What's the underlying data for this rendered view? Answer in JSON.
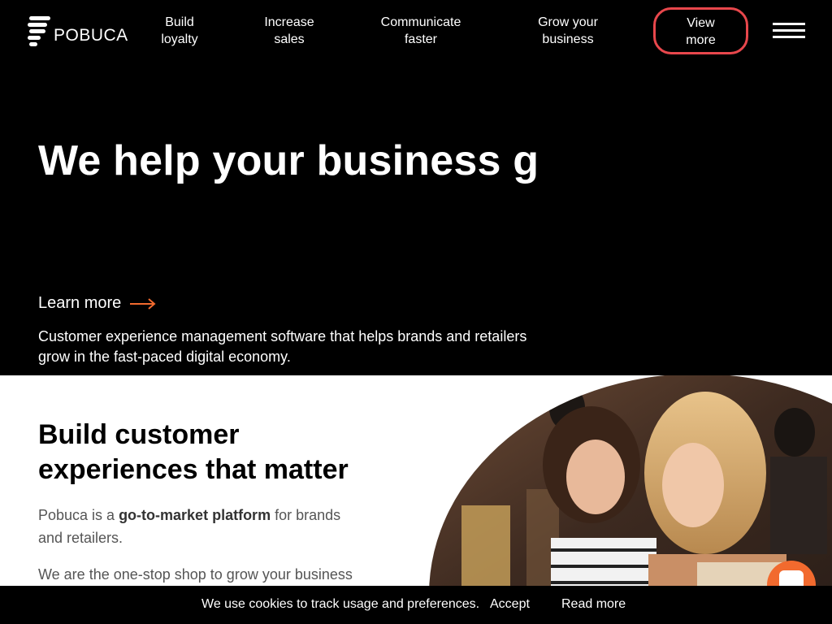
{
  "header": {
    "logo_text": "POBUCA",
    "nav": [
      {
        "line1": "Build",
        "line2": "loyalty"
      },
      {
        "line1": "Increase",
        "line2": "sales"
      },
      {
        "line1": "Communicate",
        "line2": "faster"
      },
      {
        "line1": "Grow your",
        "line2": "business"
      }
    ],
    "cta": {
      "line1": "View",
      "line2": "more"
    },
    "accent_color": "#e8474c"
  },
  "hero": {
    "title": "We help your business g",
    "learn_more": "Learn more",
    "arrow_color": "#f26a2e",
    "description": "Customer experience management software that helps brands and retailers grow in the fast-paced digital economy."
  },
  "section": {
    "title_line1": "Build customer",
    "title_line2": "experiences that matter",
    "p1_before": "Pobuca is a ",
    "p1_bold": "go-to-market platform",
    "p1_after": " for brands and retailers.",
    "p2": "We are the one-stop shop to grow your business"
  },
  "chat": {
    "color": "#f26a2e",
    "icon": "chat-icon"
  },
  "cookie": {
    "text": "We use cookies to track usage and preferences.",
    "accept": "Accept",
    "read_more": "Read more"
  }
}
